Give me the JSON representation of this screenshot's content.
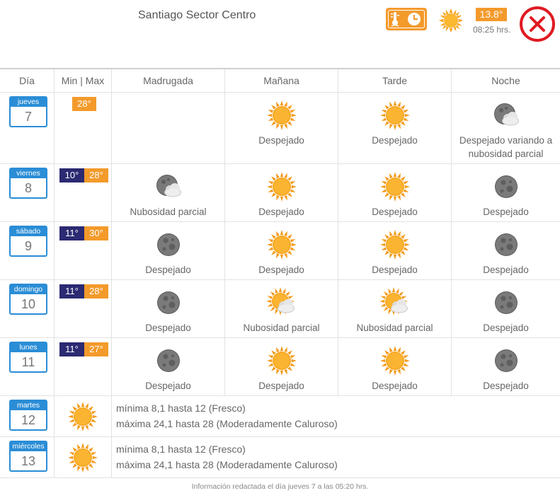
{
  "header": {
    "location": "Santiago Sector Centro",
    "current_temp": "13.8°",
    "updated_time": "08:25 hrs."
  },
  "table": {
    "headers": [
      "Día",
      "Min | Max",
      "Madrugada",
      "Mañana",
      "Tarde",
      "Noche"
    ]
  },
  "days": [
    {
      "day_name": "jueves",
      "day_num": "7",
      "min": "",
      "max": "28°",
      "periods": [
        {
          "icon": "none",
          "label": ""
        },
        {
          "icon": "sun",
          "label": "Despejado"
        },
        {
          "icon": "sun",
          "label": "Despejado"
        },
        {
          "icon": "moon-cloud",
          "label": "Despejado variando a nubosidad parcial"
        }
      ]
    },
    {
      "day_name": "viernes",
      "day_num": "8",
      "min": "10°",
      "max": "28°",
      "periods": [
        {
          "icon": "moon-cloud",
          "label": "Nubosidad parcial"
        },
        {
          "icon": "sun",
          "label": "Despejado"
        },
        {
          "icon": "sun",
          "label": "Despejado"
        },
        {
          "icon": "moon",
          "label": "Despejado"
        }
      ]
    },
    {
      "day_name": "sábado",
      "day_num": "9",
      "min": "11°",
      "max": "30°",
      "periods": [
        {
          "icon": "moon",
          "label": "Despejado"
        },
        {
          "icon": "sun",
          "label": "Despejado"
        },
        {
          "icon": "sun",
          "label": "Despejado"
        },
        {
          "icon": "moon",
          "label": "Despejado"
        }
      ]
    },
    {
      "day_name": "domingo",
      "day_num": "10",
      "min": "11°",
      "max": "28°",
      "periods": [
        {
          "icon": "moon",
          "label": "Despejado"
        },
        {
          "icon": "sun-cloud",
          "label": "Nubosidad parcial"
        },
        {
          "icon": "sun-cloud",
          "label": "Nubosidad parcial"
        },
        {
          "icon": "moon",
          "label": "Despejado"
        }
      ]
    },
    {
      "day_name": "lunes",
      "day_num": "11",
      "min": "11°",
      "max": "27°",
      "periods": [
        {
          "icon": "moon",
          "label": "Despejado"
        },
        {
          "icon": "sun",
          "label": "Despejado"
        },
        {
          "icon": "sun",
          "label": "Despejado"
        },
        {
          "icon": "moon",
          "label": "Despejado"
        }
      ]
    }
  ],
  "extended": [
    {
      "day_name": "martes",
      "day_num": "12",
      "icon": "sun",
      "line1": "mínima 8,1 hasta 12 (Fresco)",
      "line2": "máxima 24,1 hasta 28 (Moderadamente Caluroso)"
    },
    {
      "day_name": "miércoles",
      "day_num": "13",
      "icon": "sun",
      "line1": "mínima 8,1 hasta 12 (Fresco)",
      "line2": "máxima 24,1 hasta 28 (Moderadamente Caluroso)"
    }
  ],
  "footer": "Información redactada el día jueves 7 a las 05:20 hrs.",
  "colors": {
    "orange": "#f39a2b",
    "navy": "#2b2a72",
    "blue": "#2a8dd6",
    "red": "#e01a22"
  }
}
